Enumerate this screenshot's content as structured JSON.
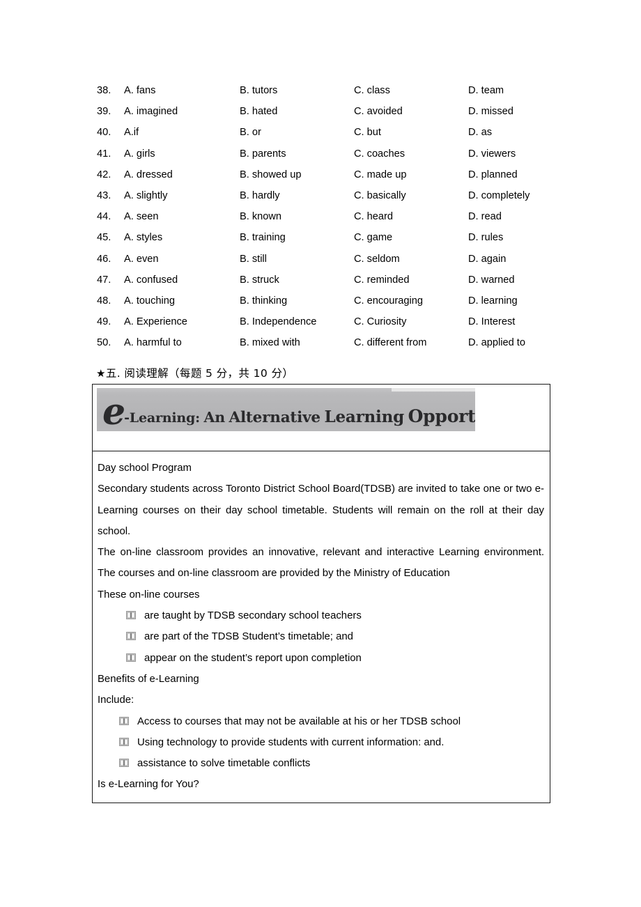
{
  "questions": {
    "columns": [
      "A",
      "B",
      "C",
      "D"
    ],
    "rows": [
      {
        "num": "38.",
        "a": "A. fans",
        "b": "B. tutors",
        "c": "C. class",
        "d": "D. team"
      },
      {
        "num": "39.",
        "a": "A. imagined",
        "b": "B. hated",
        "c": "C. avoided",
        "d": "D. missed"
      },
      {
        "num": "40.",
        "a": "A.if",
        "b": "B. or",
        "c": "C. but",
        "d": "D. as"
      },
      {
        "num": "41.",
        "a": "A. girls",
        "b": "B. parents",
        "c": "C. coaches",
        "d": "D. viewers"
      },
      {
        "num": "42.",
        "a": "A. dressed",
        "b": "B. showed up",
        "c": "C. made up",
        "d": "D. planned"
      },
      {
        "num": "43.",
        "a": "A. slightly",
        "b": "B. hardly",
        "c": "C. basically",
        "d": "D. completely"
      },
      {
        "num": "44.",
        "a": "A. seen",
        "b": "B. known",
        "c": "C. heard",
        "d": "D. read"
      },
      {
        "num": "45.",
        "a": "A. styles",
        "b": "B. training",
        "c": "C. game",
        "d": "D. rules"
      },
      {
        "num": "46.",
        "a": "A. even",
        "b": "B. still",
        "c": "C. seldom",
        "d": "D. again"
      },
      {
        "num": "47.",
        "a": "A. confused",
        "b": "B. struck",
        "c": "C. reminded",
        "d": "D. warned"
      },
      {
        "num": "48.",
        "a": "A. touching",
        "b": "B. thinking",
        "c": "C. encouraging",
        "d": "D. learning"
      },
      {
        "num": "49.",
        "a": "A. Experience",
        "b": "B. Independence",
        "c": "C. Curiosity",
        "d": "D. Interest"
      },
      {
        "num": "50.",
        "a": "A. harmful to",
        "b": "B. mixed with",
        "c": "C. different from",
        "d": "D. applied to"
      }
    ]
  },
  "section": {
    "star": "★",
    "heading": "五. 阅读理解（每题 5 分，共 10 分）"
  },
  "passage": {
    "banner": {
      "e": "e",
      "w1": "-Learning:",
      "w2": "An",
      "w3": "Alternative",
      "w4": "Learning",
      "w5": "Opportunity",
      "bg_color": "#b7b7b9",
      "text_color": "#2a2a2c"
    },
    "heading_day_school": "Day school Program",
    "para_1": "Secondary students across Toronto District School Board(TDSB) are invited to take one or two e-Learning courses on their day school timetable. Students will remain on the roll at their day school.",
    "para_2": "The on-line classroom provides an innovative, relevant and interactive Learning environment. The courses and on-line classroom are provided by the Ministry of Education",
    "heading_these_courses": "These on-line courses",
    "courses_bullets": [
      "are taught by TDSB secondary school teachers",
      "are part of the TDSB Student’s timetable; and",
      "appear on the student’s report upon completion"
    ],
    "heading_benefits": "Benefits of e-Learning",
    "heading_include": "Include:",
    "benefits_bullets": [
      "Access to courses that may not be available at his or her TDSB school",
      "Using technology to provide students with current information: and.",
      "assistance to solve timetable conflicts"
    ],
    "closing_question": "Is e-Learning for You?",
    "bullet_icon": "open-book-icon"
  }
}
